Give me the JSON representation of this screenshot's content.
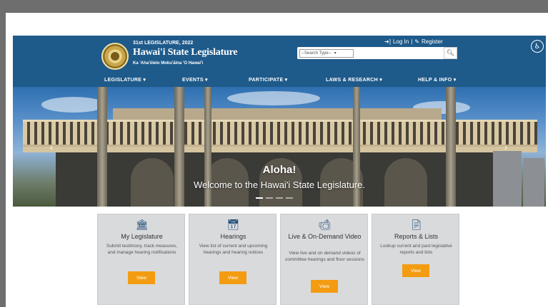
{
  "header": {
    "session": "31st LEGISLATURE, 2022",
    "title": "Hawai'i State Legislature",
    "motto": "Ka 'Aha'ōlelo Moku'āina 'O Hawai'i",
    "login_label": "Log In",
    "separator": "|",
    "register_label": "Register",
    "search": {
      "type_label": "--Search Type--",
      "placeholder": ""
    }
  },
  "nav": {
    "items": [
      "LEGISLATURE ▾",
      "EVENTS ▾",
      "PARTICIPATE ▾",
      "LAWS & RESEARCH ▾",
      "HELP & INFO ▾"
    ]
  },
  "hero": {
    "title": "Aloha!",
    "subtitle": "Welcome to the Hawai'i State Legislature."
  },
  "cards": [
    {
      "icon": "building-icon",
      "title": "My Legislature",
      "description": "Submit testimony, track measures, and manage hearing notifications",
      "button": "View"
    },
    {
      "icon": "calendar-icon",
      "title": "Hearings",
      "description": "View list of current and upcoming hearings and hearing notices",
      "button": "View"
    },
    {
      "icon": "video-camera-icon",
      "title": "Live & On-Demand Video",
      "description": "View live and on demand videos of committee hearings and floor sessions",
      "button": "View"
    },
    {
      "icon": "document-icon",
      "title": "Reports & Lists",
      "description": "Lookup current and past legislative reports and lists",
      "button": "View"
    }
  ],
  "colors": {
    "header_bg": "#1e5a8a",
    "button_accent": "#f39c12",
    "card_bg": "#d9dadc"
  }
}
